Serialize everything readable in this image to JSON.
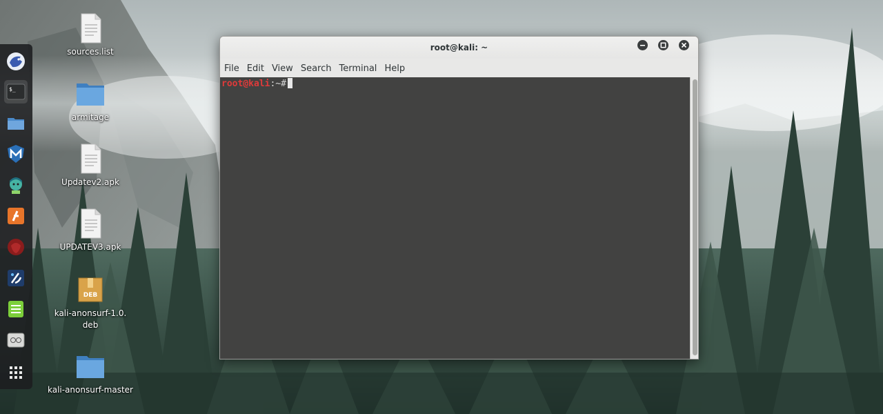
{
  "terminal": {
    "title": "root@kali: ~",
    "menu": [
      "File",
      "Edit",
      "View",
      "Search",
      "Terminal",
      "Help"
    ],
    "prompt": {
      "user": "root@kali",
      "path": ":~#"
    }
  },
  "desktop": {
    "icons": [
      {
        "label": "sources.list",
        "icon": "text-file-icon"
      },
      {
        "label": "armitage",
        "icon": "folder-icon"
      },
      {
        "label": "Updatev2.apk",
        "icon": "text-file-icon"
      },
      {
        "label": "UPDATEV3.apk",
        "icon": "text-file-icon"
      },
      {
        "label": "kali-anonsurf-1.0.deb",
        "icon": "deb-package-icon",
        "badge": "DEB"
      },
      {
        "label": "kali-anonsurf-master",
        "icon": "folder-icon"
      }
    ]
  },
  "dock": {
    "items": [
      "iceweasel-icon",
      "terminal-icon",
      "files-icon",
      "metasploit-icon",
      "armitage-icon",
      "burpsuite-icon",
      "beef-icon",
      "faraday-icon",
      "leafpad-icon",
      "recorder-icon",
      "show-applications-icon"
    ]
  },
  "colors": {
    "prompt_user": "#e03a3a",
    "terminal_bg": "#181818",
    "titlebar": "#e8e8e7"
  }
}
